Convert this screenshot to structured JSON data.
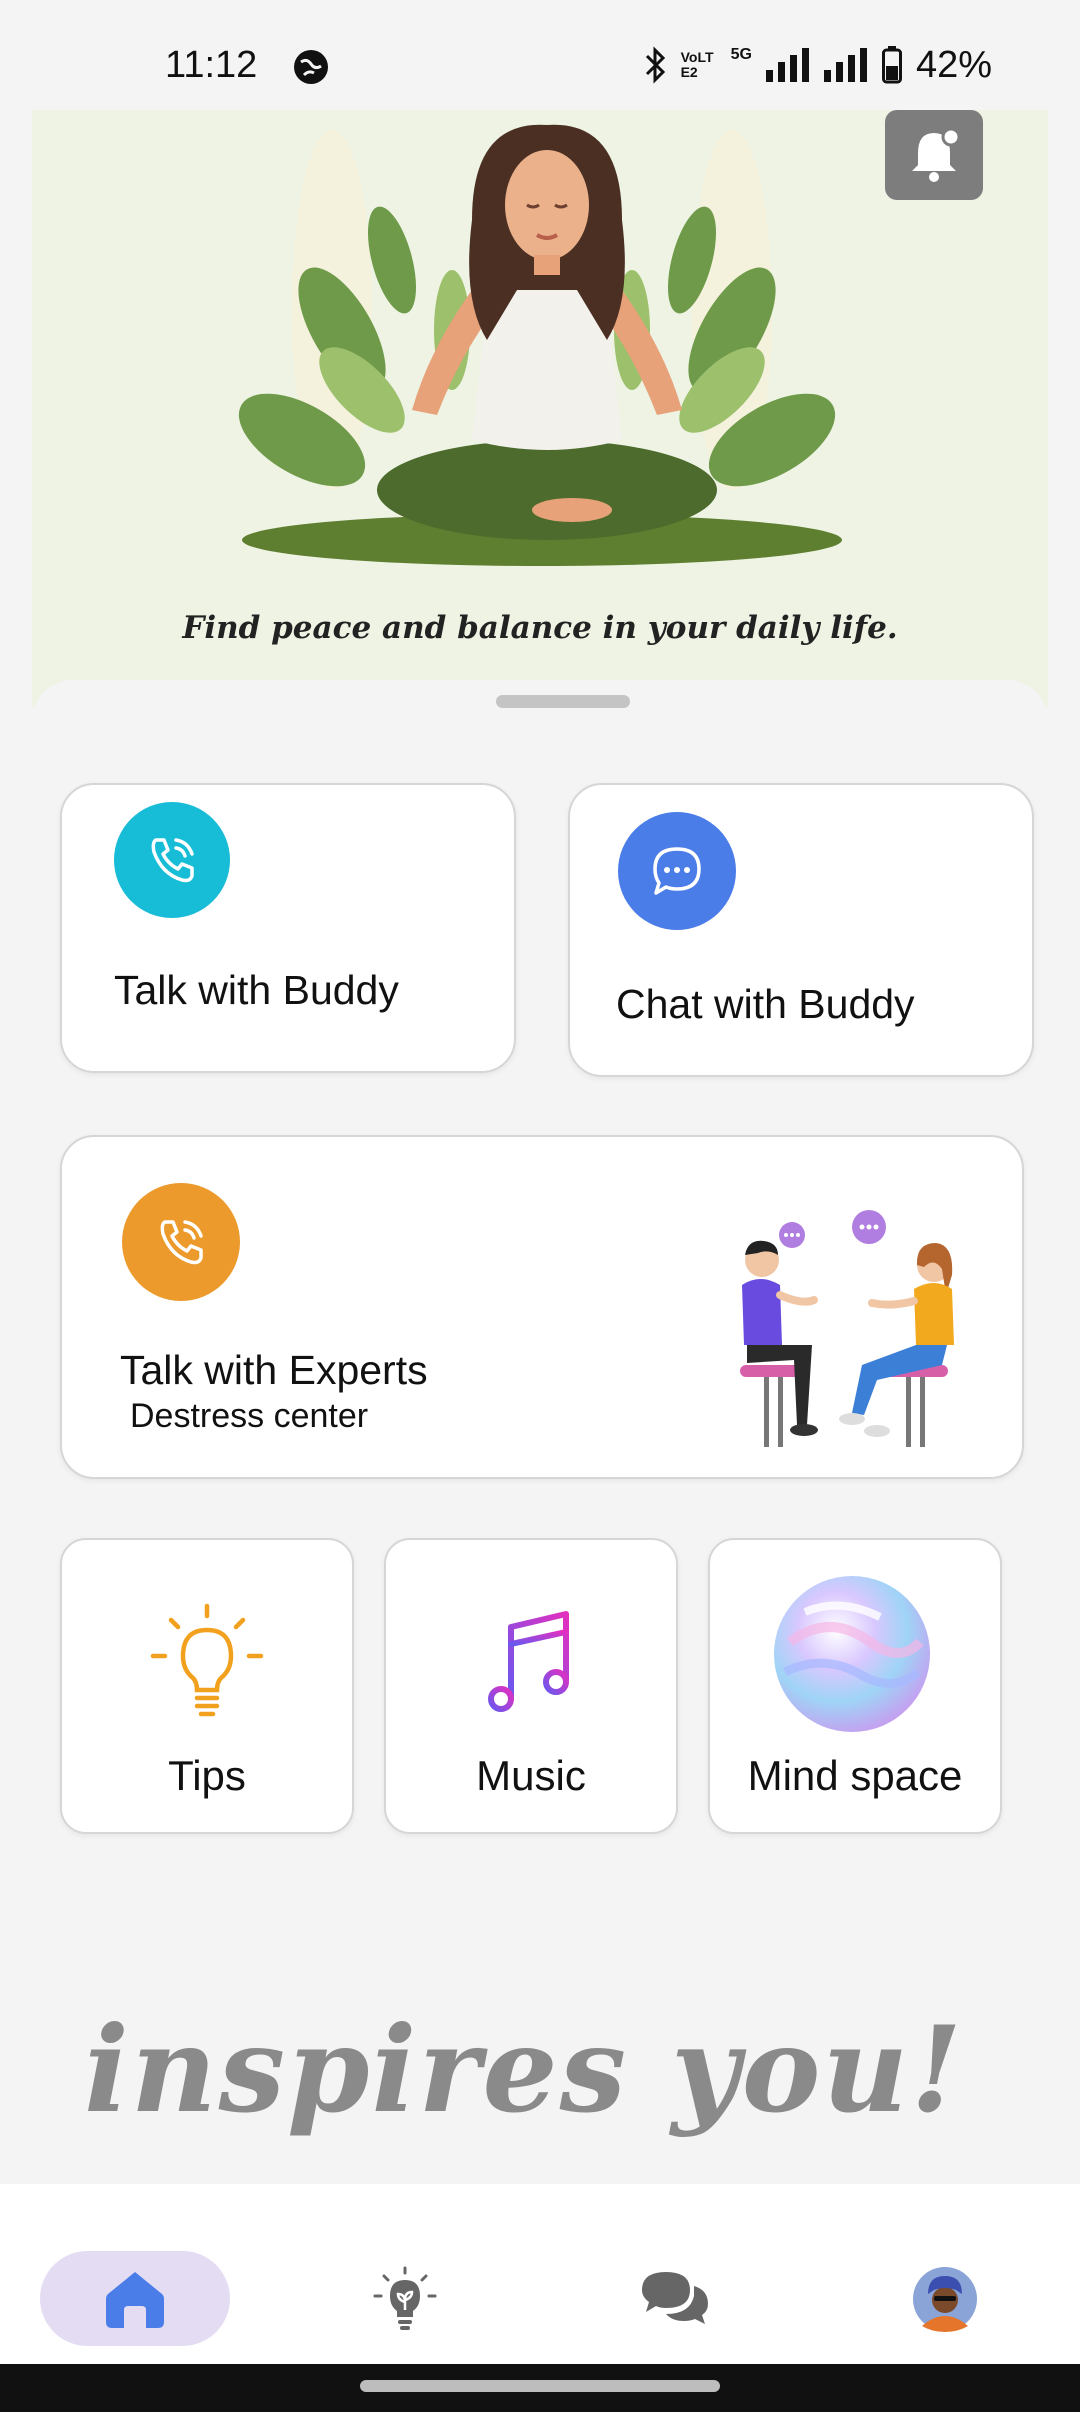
{
  "status_bar": {
    "time": "11:12",
    "network_labels": [
      "VoLTE2",
      "5G"
    ],
    "battery": "42%"
  },
  "hero": {
    "caption": "Find peace and balance in your daily life.",
    "notification_icon": "bell-icon"
  },
  "cards": {
    "talk_buddy": {
      "label": "Talk with Buddy",
      "icon": "phone-call-icon",
      "color": "#17bcd6"
    },
    "chat_buddy": {
      "label": "Chat with Buddy",
      "icon": "chat-bubble-icon",
      "color": "#4a7de8"
    },
    "talk_experts": {
      "label": "Talk with Experts",
      "sublabel": "Destress center",
      "icon": "phone-call-icon",
      "color": "#ec9a2c"
    }
  },
  "tiles": [
    {
      "label": "Tips",
      "icon": "lightbulb-icon"
    },
    {
      "label": "Music",
      "icon": "music-note-icon"
    },
    {
      "label": "Mind space",
      "icon": "orb-icon"
    }
  ],
  "banner": {
    "text": "inspires you!"
  },
  "bottom_nav": [
    {
      "name": "home",
      "icon": "home-icon",
      "active": true
    },
    {
      "name": "tips",
      "icon": "lightbulb-plant-icon",
      "active": false
    },
    {
      "name": "chats",
      "icon": "chat-icon",
      "active": false
    },
    {
      "name": "profile",
      "icon": "avatar-icon",
      "active": false
    }
  ],
  "colors": {
    "accent": "#4a7de8",
    "active_pill": "#e3dcf3",
    "background": "#f4f4f4"
  }
}
